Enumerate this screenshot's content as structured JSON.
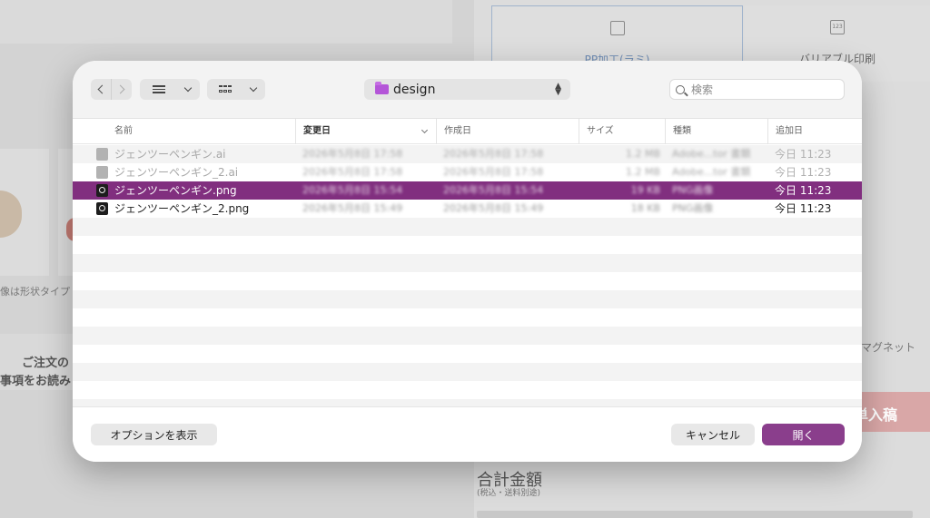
{
  "background": {
    "option_one_label": "PP加工(ラミ)",
    "option_two_label": "バリアブル印刷",
    "option_two_icon_text": "123",
    "shape_note": "像は形状タイプ",
    "order_line1": "ご注文の",
    "order_line2": "事項をお読み",
    "magnet_label": "マグネット",
    "cta_label": "単入稿",
    "total_label": "合計金額",
    "total_sub": "(税込・送料別途)"
  },
  "dialog": {
    "nav_back_icon": "chevron-left-icon",
    "nav_forward_icon": "chevron-right-icon",
    "current_folder": "design",
    "search_placeholder": "検索",
    "columns": {
      "name": "名前",
      "modified": "変更日",
      "created": "作成日",
      "size": "サイズ",
      "kind": "種類",
      "added": "追加日"
    },
    "files": [
      {
        "name": "ジェンツーペンギン.ai",
        "modified": "2026年5月8日 17:58",
        "created": "2026年5月8日 17:58",
        "size": "1.2 MB",
        "kind": "Adobe...tor 書類",
        "added": "今日 11:23",
        "state": "dimmed"
      },
      {
        "name": "ジェンツーペンギン_2.ai",
        "modified": "2026年5月8日 17:58",
        "created": "2026年5月8日 17:58",
        "size": "1.2 MB",
        "kind": "Adobe...tor 書類",
        "added": "今日 11:23",
        "state": "dimmed"
      },
      {
        "name": "ジェンツーペンギン.png",
        "modified": "2026年5月8日 15:54",
        "created": "2026年5月8日 15:54",
        "size": "19 KB",
        "kind": "PNG画像",
        "added": "今日 11:23",
        "state": "selected"
      },
      {
        "name": "ジェンツーペンギン_2.png",
        "modified": "2026年5月8日 15:49",
        "created": "2026年5月8日 15:49",
        "size": "18 KB",
        "kind": "PNG画像",
        "added": "今日 11:23",
        "state": "normal"
      }
    ],
    "buttons": {
      "options": "オプションを表示",
      "cancel": "キャンセル",
      "open": "開く"
    },
    "colors": {
      "selection": "#812f7f",
      "open_button": "#8a3e8c",
      "folder": "#b455d8"
    }
  }
}
